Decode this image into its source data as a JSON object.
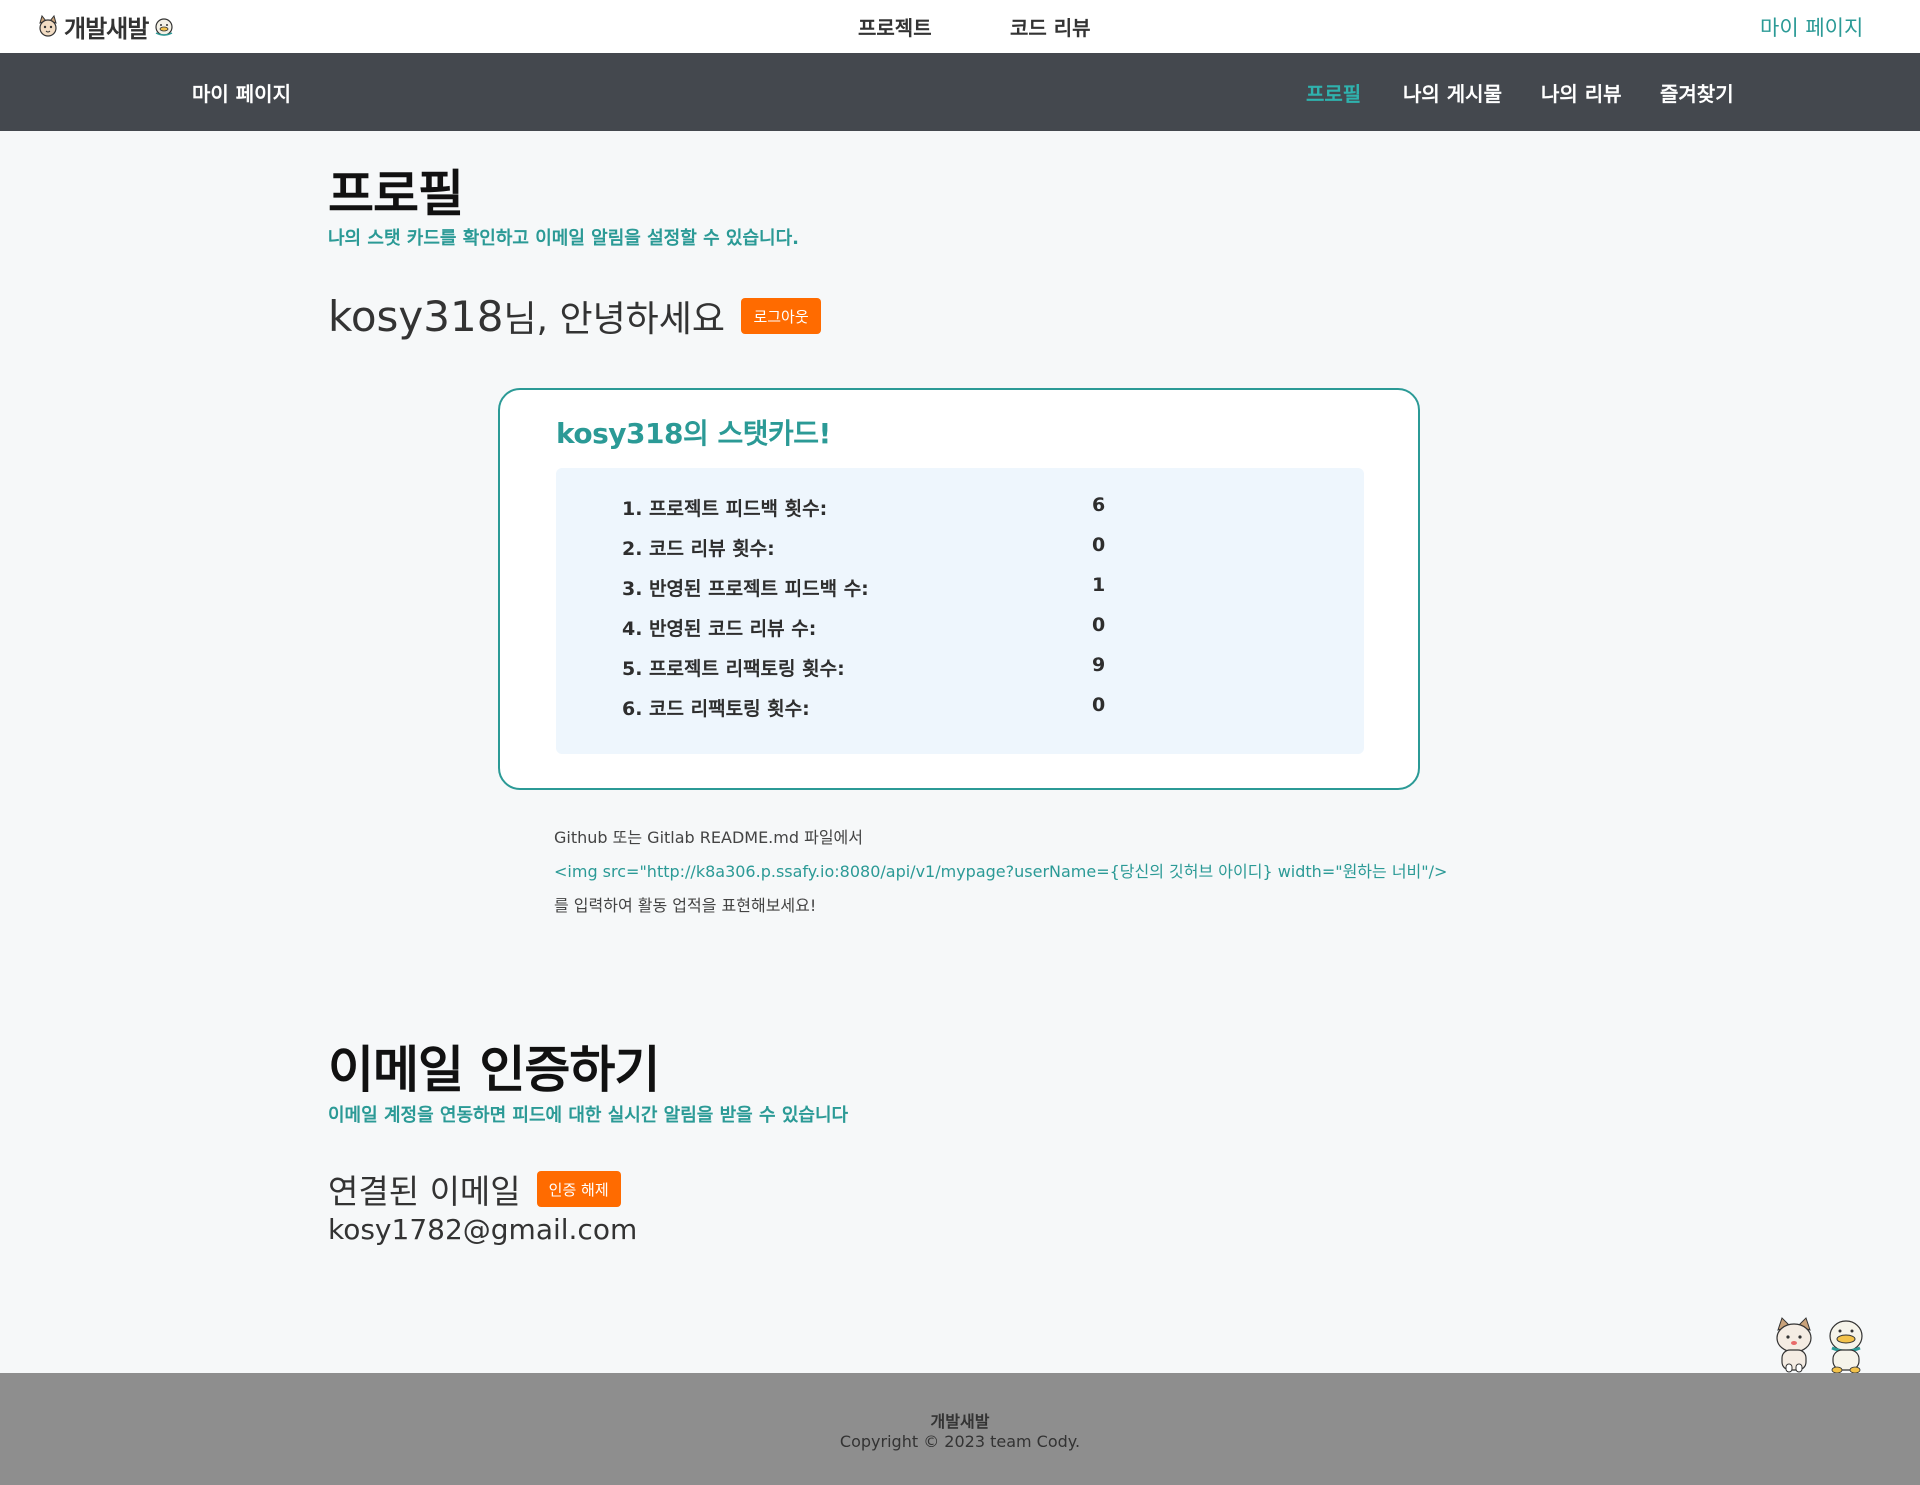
{
  "header": {
    "brand": "개발새발",
    "nav": {
      "projects": "프로젝트",
      "code_review": "코드 리뷰",
      "mypage": "마이 페이지"
    }
  },
  "subnav": {
    "title": "마이 페이지",
    "tabs": [
      "프로필",
      "나의 게시물",
      "나의 리뷰",
      "즐겨찾기"
    ],
    "active_tab": "프로필"
  },
  "profile": {
    "heading": "프로필",
    "caption": "나의 스탯 카드를 확인하고 이메일 알림을 설정할 수 있습니다.",
    "nickname": "kosy318",
    "greeting_suffix": "님, 안녕하세요",
    "logout_label": "로그아웃"
  },
  "stat_card": {
    "title": "kosy318의 스탯카드!",
    "rows": [
      {
        "label": "1. 프로젝트 피드백 횟수:",
        "value": "6"
      },
      {
        "label": "2. 코드 리뷰 횟수:",
        "value": "0"
      },
      {
        "label": "3. 반영된 프로젝트 피드백 수:",
        "value": "1"
      },
      {
        "label": "4. 반영된 코드 리뷰 수:",
        "value": "0"
      },
      {
        "label": "5. 프로젝트 리팩토링 횟수:",
        "value": "9"
      },
      {
        "label": "6. 코드 리팩토링 횟수:",
        "value": "0"
      }
    ]
  },
  "readme_hint": {
    "line1": "Github 또는 Gitlab README.md 파일에서",
    "line2": "<img src=\"http://k8a306.p.ssafy.io:8080/api/v1/mypage?userName={당신의 깃허브 아이디} width=\"원하는 너비\"/>",
    "line3": "를 입력하여 활동 업적을 표현해보세요!"
  },
  "email": {
    "heading": "이메일 인증하기",
    "caption": "이메일 계정을 연동하면 피드에 대한 실시간 알림을 받을 수 있습니다",
    "label": "연결된 이메일",
    "unlink_label": "인증 해제",
    "address": "kosy1782@gmail.com"
  },
  "footer": {
    "brand": "개발새발",
    "copyright": "Copyright © 2023 team Cody."
  },
  "colors": {
    "accent": "#2b9a96",
    "orange": "#ff6b00",
    "subbar": "#44484e",
    "footer": "#8e8e8e"
  },
  "icons": {
    "logo_left": "cat-face-icon",
    "logo_right": "duck-face-icon",
    "mascots": "mascot-illustration"
  }
}
